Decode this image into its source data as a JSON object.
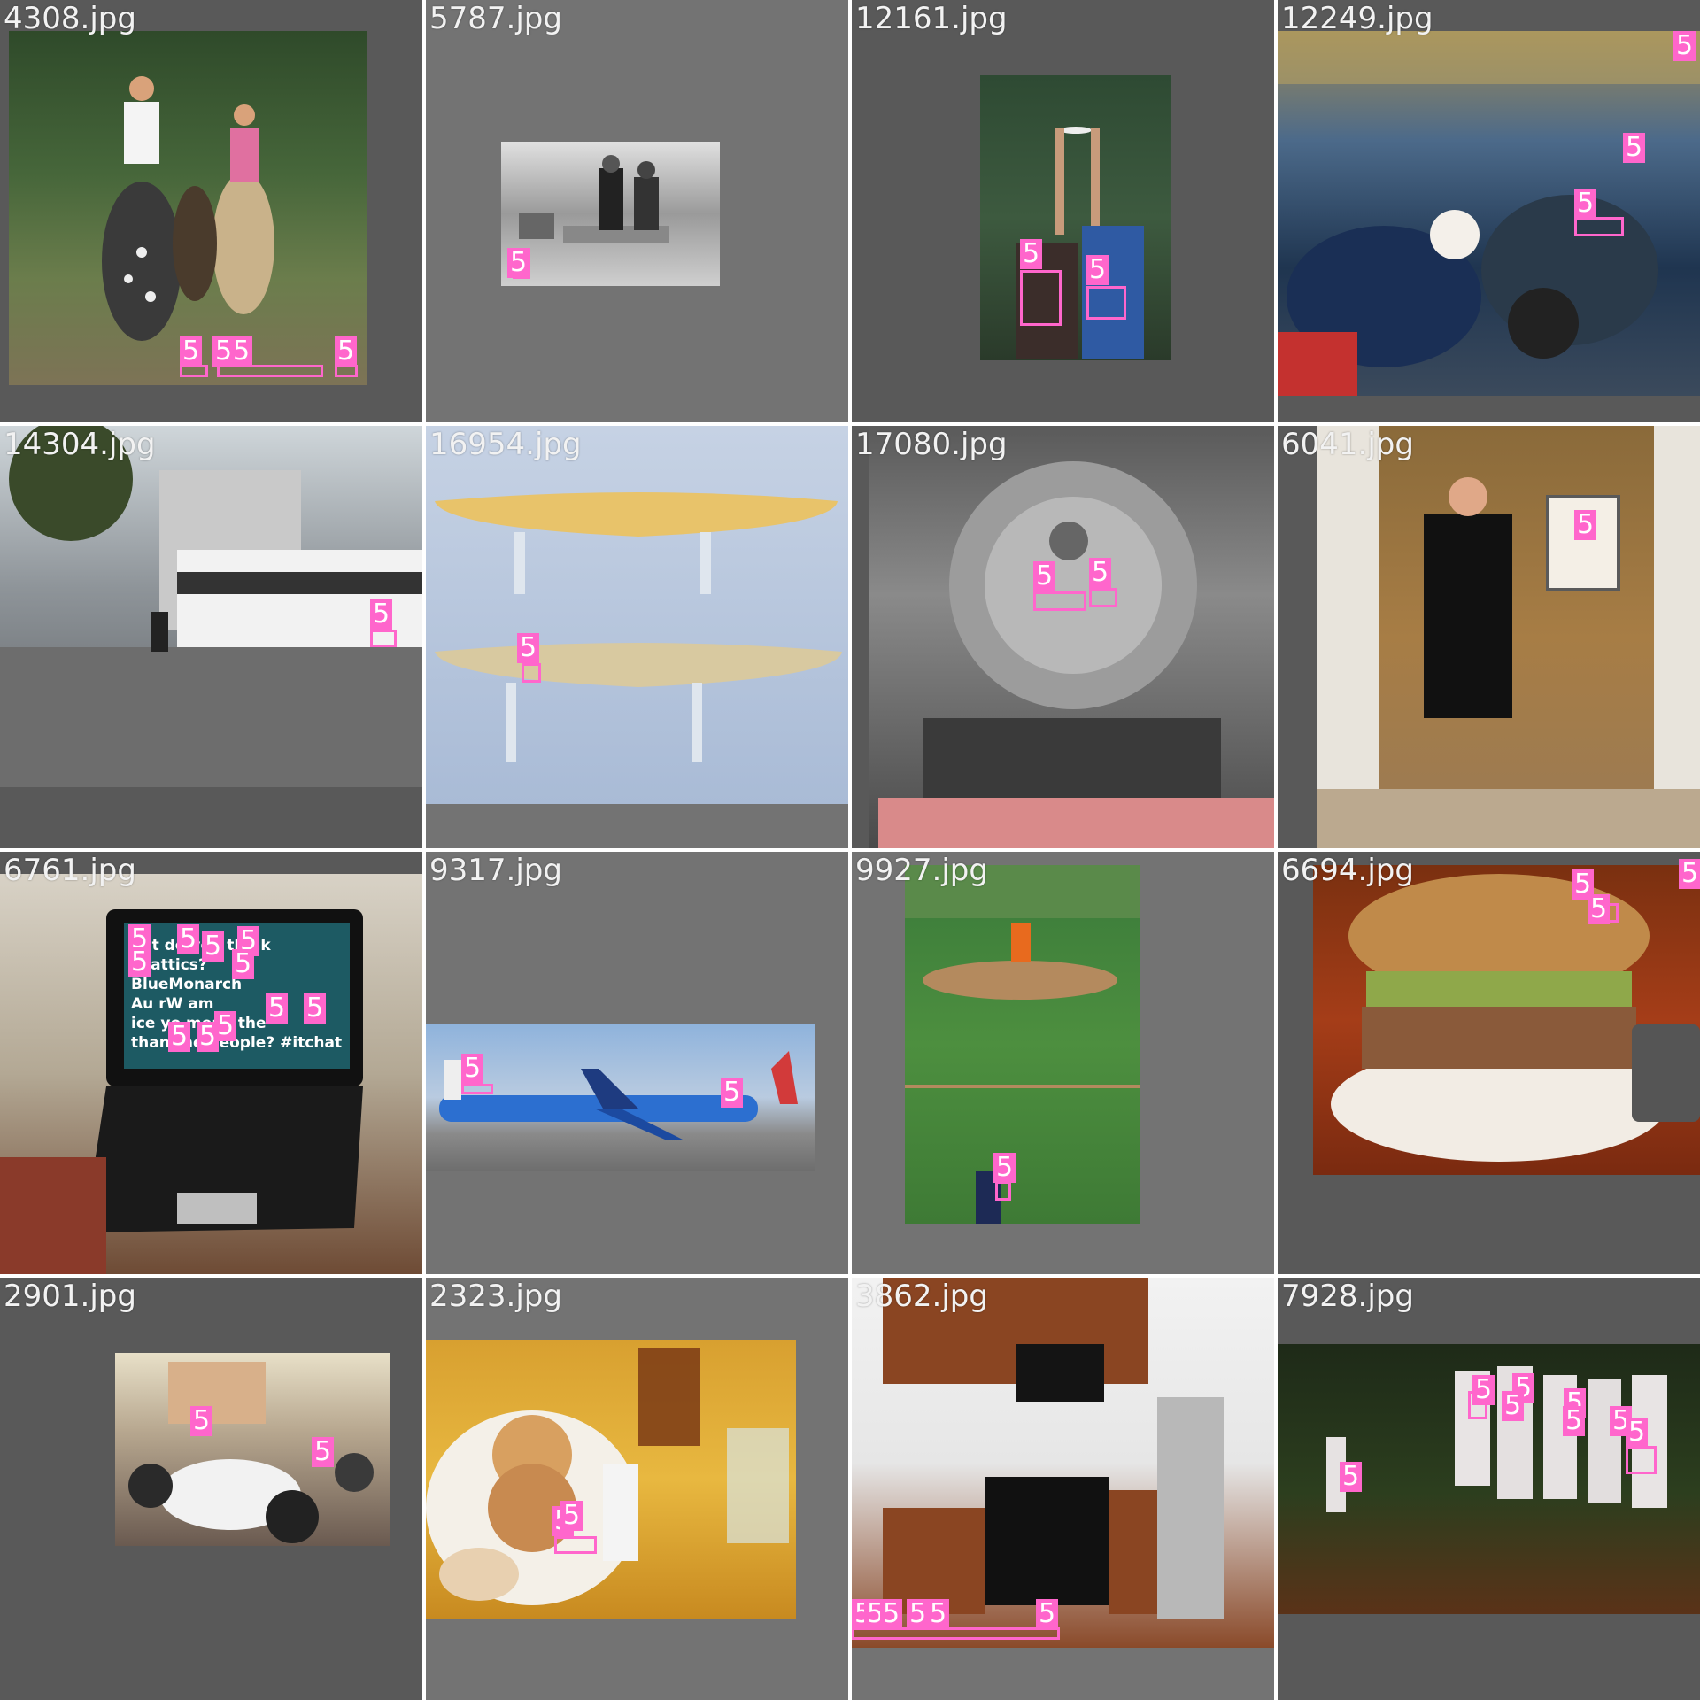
{
  "grid": {
    "cells": [
      {
        "filename": "4308.jpg"
      },
      {
        "filename": "5787.jpg"
      },
      {
        "filename": "12161.jpg"
      },
      {
        "filename": "12249.jpg"
      },
      {
        "filename": "14304.jpg"
      },
      {
        "filename": "16954.jpg"
      },
      {
        "filename": "17080.jpg"
      },
      {
        "filename": "6041.jpg"
      },
      {
        "filename": "6761.jpg"
      },
      {
        "filename": "9317.jpg"
      },
      {
        "filename": "9927.jpg"
      },
      {
        "filename": "6694.jpg"
      },
      {
        "filename": "2901.jpg"
      },
      {
        "filename": "2323.jpg"
      },
      {
        "filename": "3862.jpg"
      },
      {
        "filename": "7928.jpg"
      }
    ],
    "class_label": "5",
    "laptop_screen_words": [
      "hat",
      "do",
      "you",
      "think",
      "chattics",
      "?",
      "Blue",
      "Monarch",
      "Au",
      "rW",
      "am",
      "ice",
      "yo",
      "mean",
      "the",
      "than",
      "the",
      "people",
      "?",
      "#itchat"
    ],
    "box_color": "#ff66cc"
  }
}
